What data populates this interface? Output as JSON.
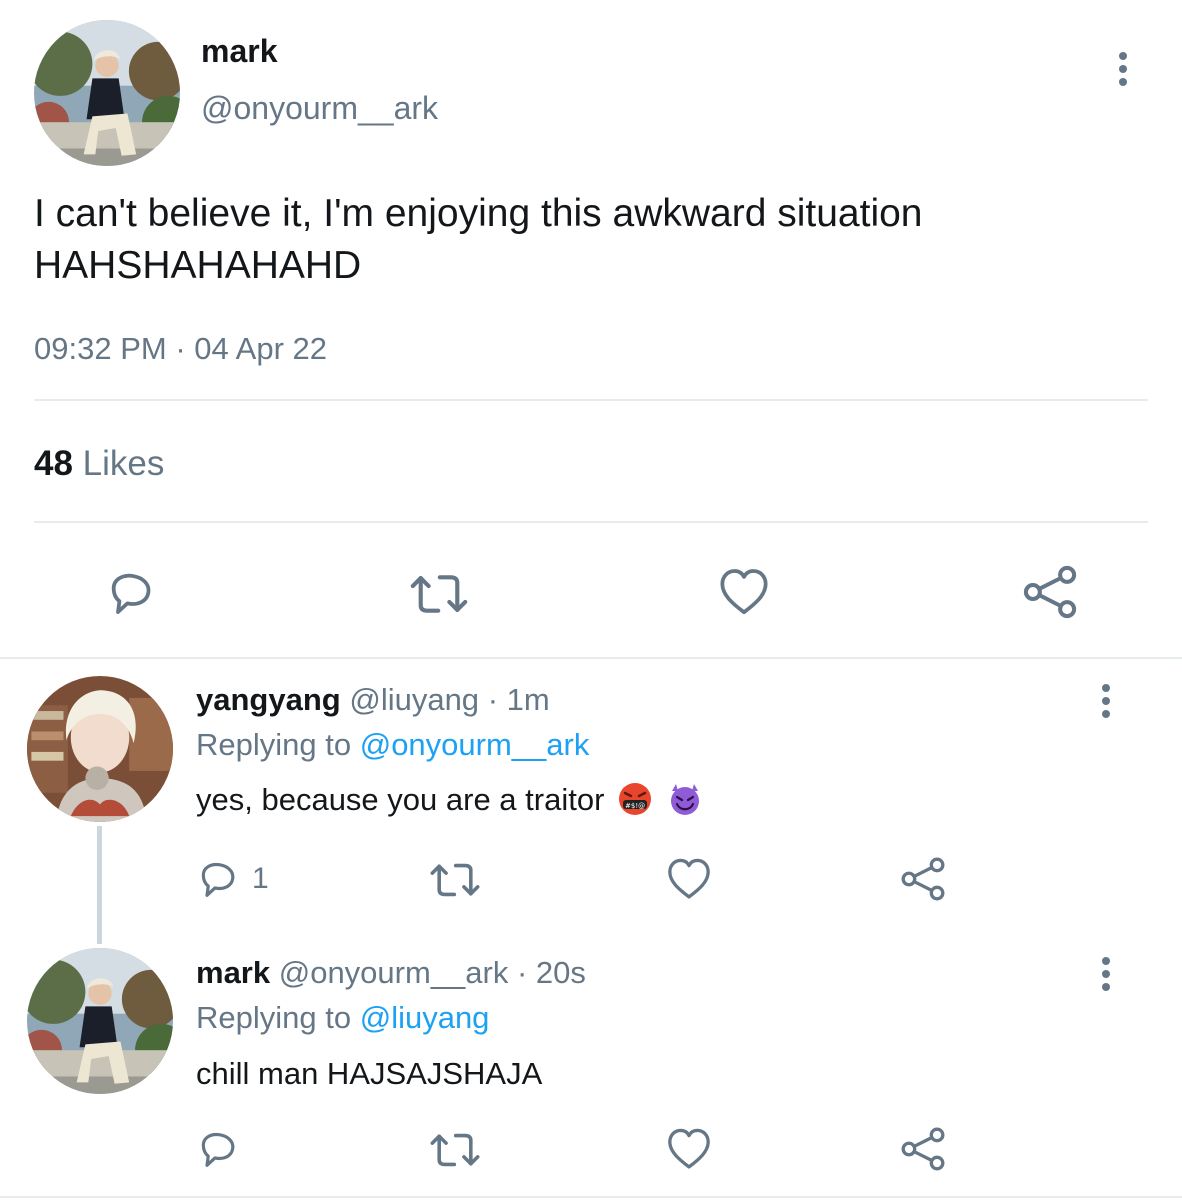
{
  "tweet": {
    "author_name": "mark",
    "author_handle": "@onyourm__ark",
    "text_line1": "I can't believe it, I'm enjoying this awkward situation",
    "text_line2": "HAHSHAHAHAHD",
    "time": "09:32 PM",
    "separator": "·",
    "date": "04 Apr 22",
    "likes_count": "48",
    "likes_label": "Likes",
    "icons": [
      "reply-icon",
      "retweet-icon",
      "like-icon",
      "share-icon",
      "more-options-icon"
    ]
  },
  "replies": [
    {
      "author_name": "yangyang",
      "author_handle": "@liuyang",
      "age": "· 1m",
      "replying_prefix": "Replying to",
      "replying_to": "@onyourm__ark",
      "text": "yes, because you are a traitor",
      "emojis": [
        "face-with-symbols-on-mouth-emoji",
        "smiling-face-with-horns-emoji"
      ],
      "reply_count": "1"
    },
    {
      "author_name": "mark",
      "author_handle": "@onyourm__ark",
      "age": "· 20s",
      "replying_prefix": "Replying to",
      "replying_to": "@liuyang",
      "text": "chill man HAJSAJSHAJA"
    }
  ],
  "colors": {
    "text": "#14171a",
    "secondary": "#657786",
    "link": "#1da1f2",
    "divider": "#e6ecf0",
    "thread_line": "#ccd6dd"
  }
}
